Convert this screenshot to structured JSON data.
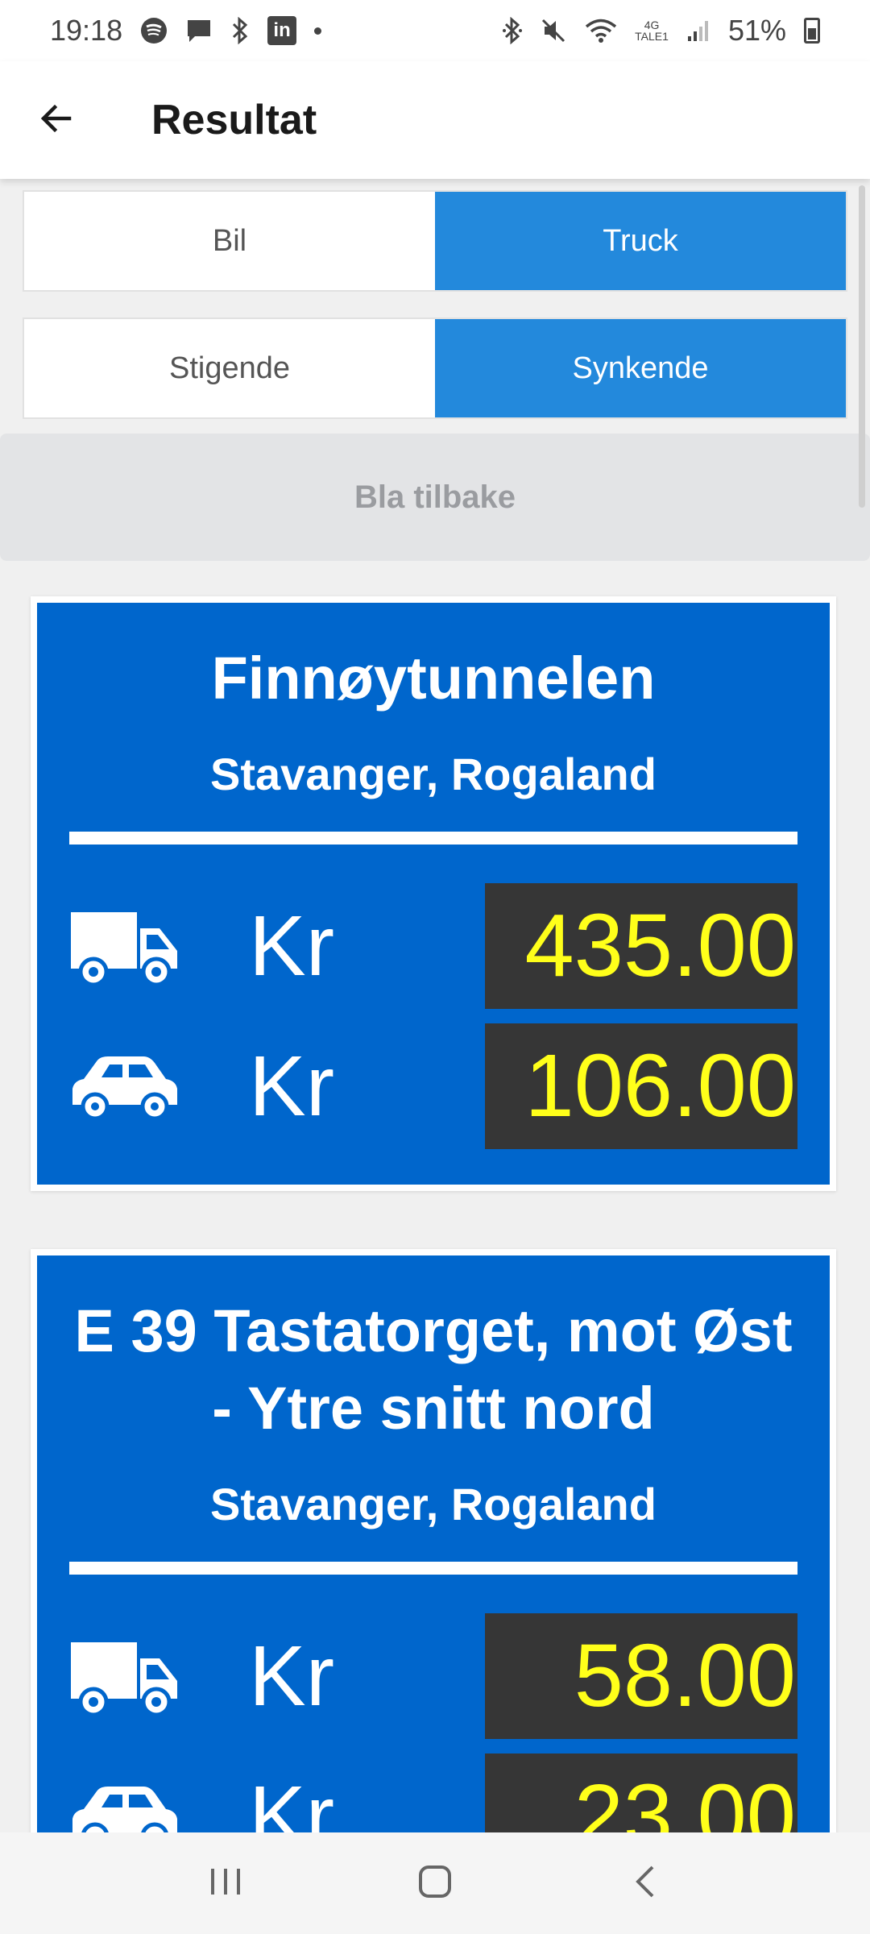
{
  "status_bar": {
    "time": "19:18",
    "battery": "51%",
    "network": "4G",
    "network_sub": "TALE1",
    "icons": [
      "spotify-icon",
      "message-icon",
      "bluetooth-icon",
      "linkedin-icon",
      "dot-icon",
      "bluetooth-icon",
      "mute-icon",
      "wifi-icon",
      "signal-icon",
      "battery-icon"
    ]
  },
  "appbar": {
    "title": "Resultat",
    "back_icon": "arrow-left-icon"
  },
  "vehicle_toggle": {
    "options": [
      "Bil",
      "Truck"
    ],
    "selected": "Truck"
  },
  "sort_toggle": {
    "options": [
      "Stigende",
      "Synkende"
    ],
    "selected": "Synkende"
  },
  "back_button": {
    "label": "Bla tilbake"
  },
  "results": [
    {
      "name": "Finnøytunnelen",
      "location": "Stavanger, Rogaland",
      "prices": [
        {
          "vehicle": "truck-icon",
          "currency": "Kr",
          "amount": "435.00"
        },
        {
          "vehicle": "car-icon",
          "currency": "Kr",
          "amount": "106.00"
        }
      ]
    },
    {
      "name": "E 39 Tastatorget, mot Øst - Ytre snitt nord",
      "location": "Stavanger, Rogaland",
      "prices": [
        {
          "vehicle": "truck-icon",
          "currency": "Kr",
          "amount": "58.00"
        },
        {
          "vehicle": "car-icon",
          "currency": "Kr",
          "amount": "23.00"
        }
      ]
    }
  ],
  "colors": {
    "accent": "#2389dc",
    "card_bg": "#0066cc",
    "price_bg": "#363636",
    "price_text": "#ffff1a"
  },
  "nav_bar": {
    "buttons": [
      "recent-apps-icon",
      "home-icon",
      "back-icon"
    ]
  }
}
